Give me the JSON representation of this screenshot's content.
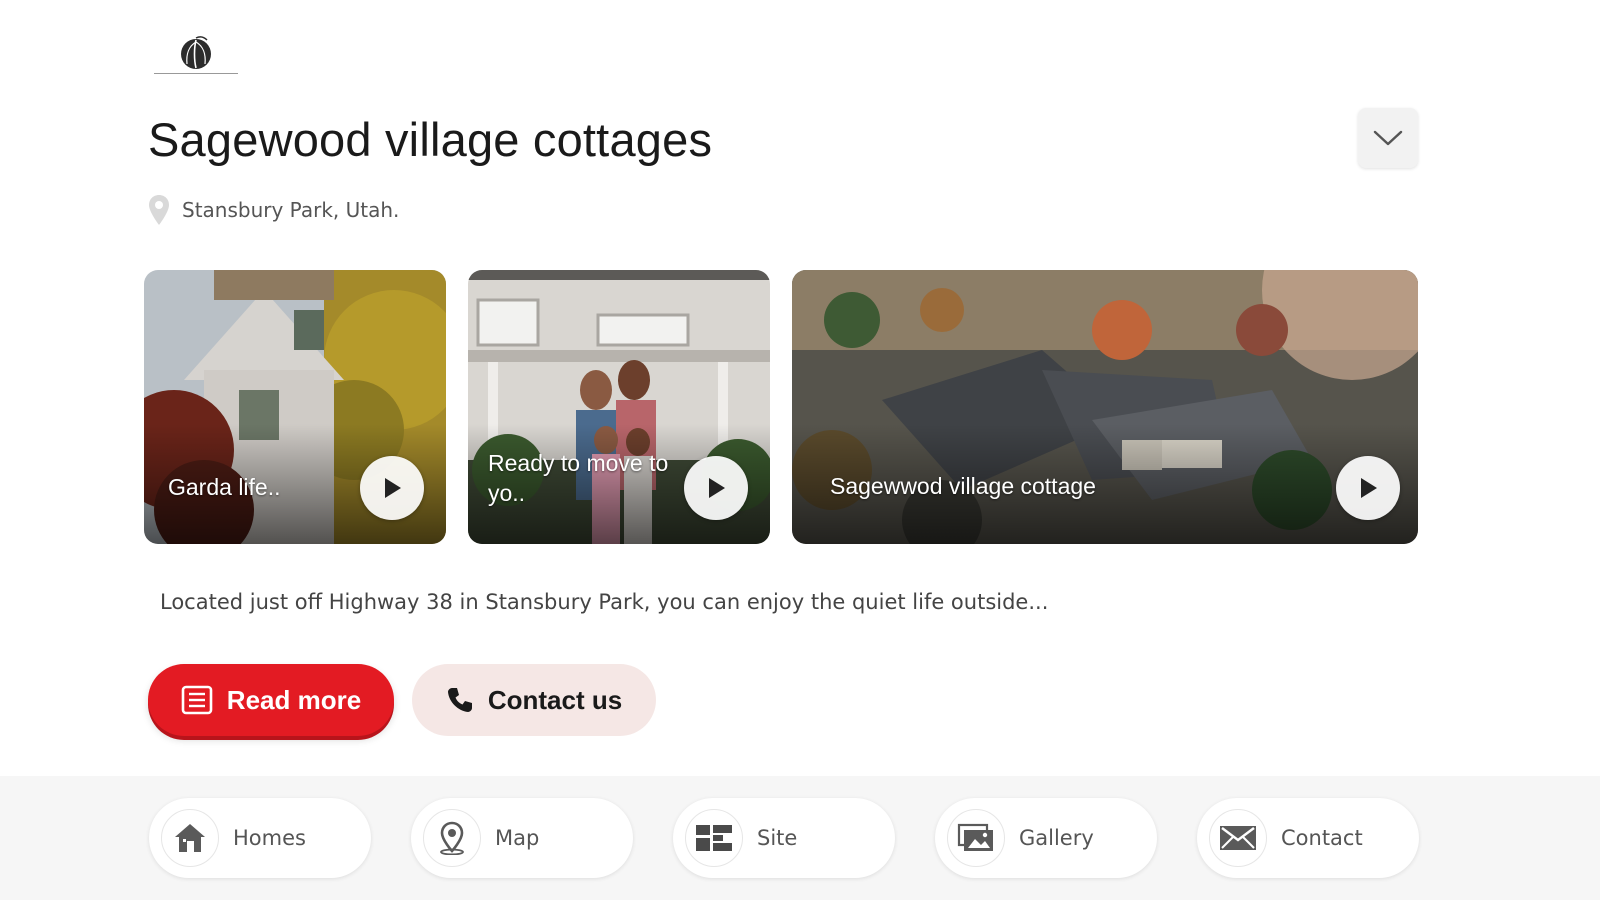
{
  "header": {
    "logo_icon": "palm-leaf-logo",
    "title": "Sagewood village cottages",
    "collapse_icon": "chevron-down-icon",
    "location_icon": "map-pin-icon",
    "location": "Stansbury Park, Utah."
  },
  "videos": [
    {
      "caption": "Garda life..",
      "icon": "play-icon"
    },
    {
      "caption": "Ready to move to yo..",
      "icon": "play-icon"
    },
    {
      "caption": "Sagewwod village cottage",
      "icon": "play-icon"
    }
  ],
  "description": "Located just off Highway 38 in Stansbury Park, you can enjoy the quiet life outside...",
  "actions": {
    "read_more": {
      "label": "Read more",
      "icon": "document-icon",
      "color": "#e31b23"
    },
    "contact_us": {
      "label": "Contact us",
      "icon": "phone-icon",
      "color": "#f5e7e5"
    }
  },
  "bottom_nav": [
    {
      "label": "Homes",
      "icon": "home-icon"
    },
    {
      "label": "Map",
      "icon": "map-pin-icon"
    },
    {
      "label": "Site",
      "icon": "site-plan-icon"
    },
    {
      "label": "Gallery",
      "icon": "gallery-icon"
    },
    {
      "label": "Contact",
      "icon": "envelope-icon"
    }
  ]
}
